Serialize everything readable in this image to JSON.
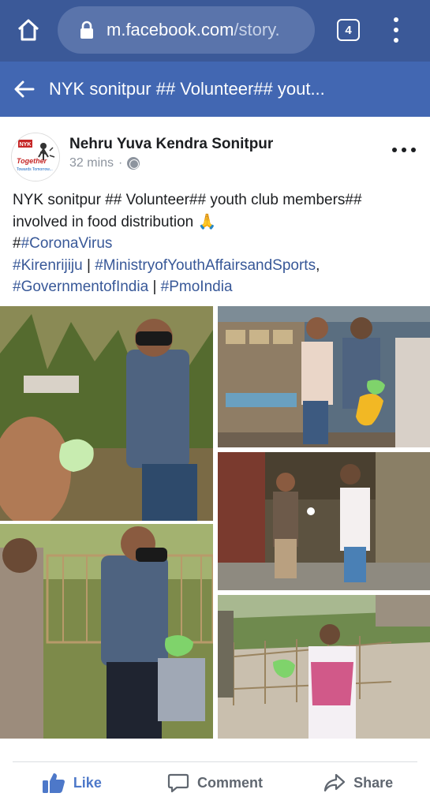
{
  "browser": {
    "url_host": "m.facebook.com",
    "url_path": "/story.",
    "tab_count": "4"
  },
  "header": {
    "title": "NYK sonitpur ## Volunteer## yout..."
  },
  "post": {
    "author": "Nehru Yuva Kendra Sonitpur",
    "time": "32 mins",
    "separator": "·",
    "avatar_text": {
      "top": "NYK",
      "line1": "Together",
      "line2": "Towards Tomorrow..."
    },
    "text_line1": "NYK sonitpur ## Volunteer## youth club members##",
    "text_line2": "involved in food distribution",
    "emoji": "🙏",
    "hash_prefix": "#",
    "hashtags": {
      "corona": "#CoronaVirus",
      "kiren": "#Kirenrijiju",
      "ministry": "#MinistryofYouthAffairsandSports",
      "govt": "#GovernmentofIndia",
      "pmo": "#PmoIndia"
    },
    "separators": {
      "pipe": " | ",
      "comma": ","
    }
  },
  "actions": {
    "like": "Like",
    "comment": "Comment",
    "share": "Share"
  },
  "colors": {
    "browser_bar": "#3b5998",
    "header_bar": "#4267b2",
    "link": "#385898",
    "like_blue": "#4d78c9"
  }
}
